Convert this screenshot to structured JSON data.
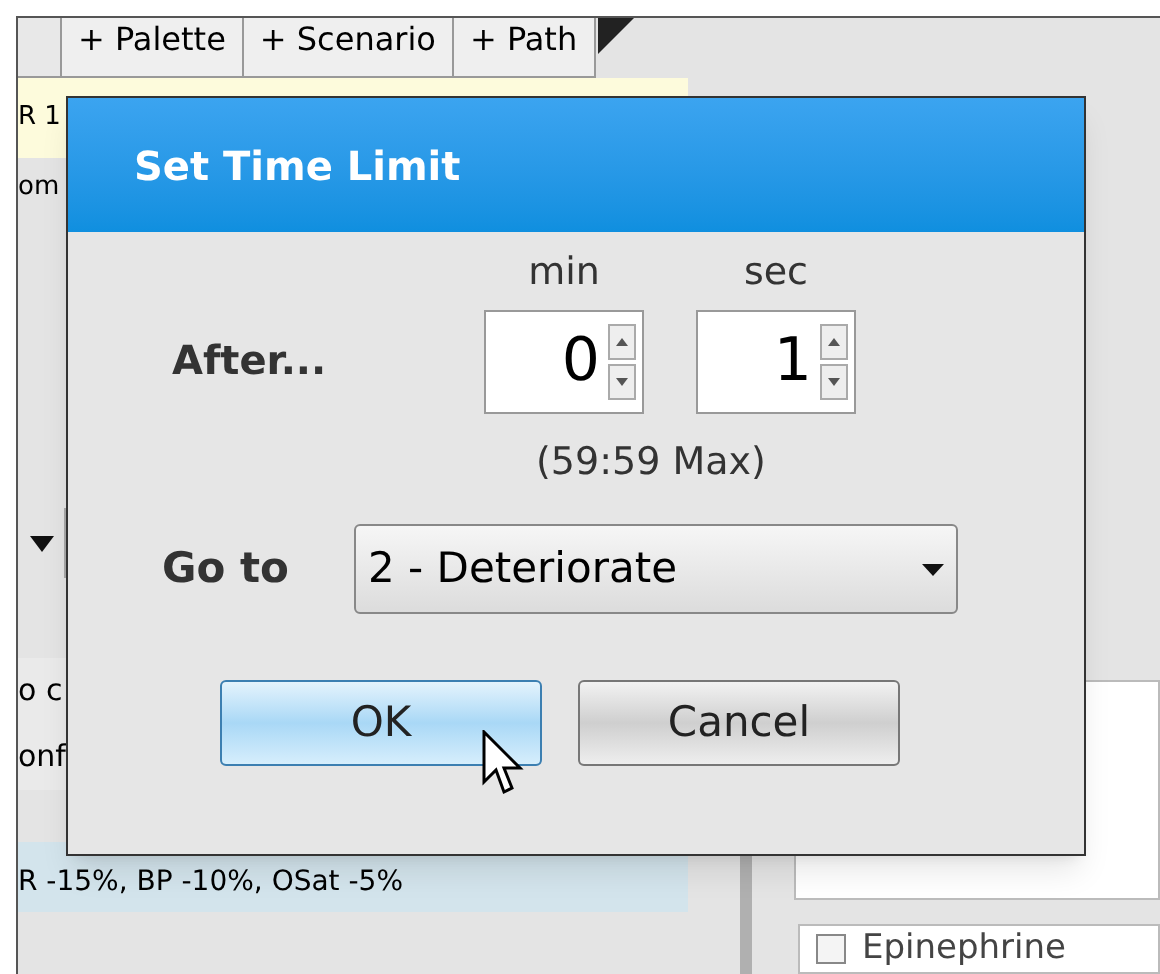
{
  "background": {
    "tabs": [
      {
        "label": "+ Palette"
      },
      {
        "label": "+ Scenario"
      },
      {
        "label": "+ Path"
      }
    ],
    "left_fragments": [
      "R 1",
      "om"
    ],
    "lower_fragments": [
      "o c",
      "onf"
    ],
    "effect_line": "R -15%, BP -10%, OSat -5%",
    "checklist": [
      {
        "label": "Epinephrine",
        "checked": false
      }
    ]
  },
  "dialog": {
    "title": "Set Time Limit",
    "after_label": "After...",
    "fields": [
      {
        "unit": "min",
        "value": "0"
      },
      {
        "unit": "sec",
        "value": "1"
      }
    ],
    "max_note": "(59:59 Max)",
    "goto_label": "Go to",
    "goto_value": "2 - Deteriorate",
    "buttons": [
      {
        "label": "OK",
        "selected": true
      },
      {
        "label": "Cancel",
        "selected": false
      }
    ]
  }
}
